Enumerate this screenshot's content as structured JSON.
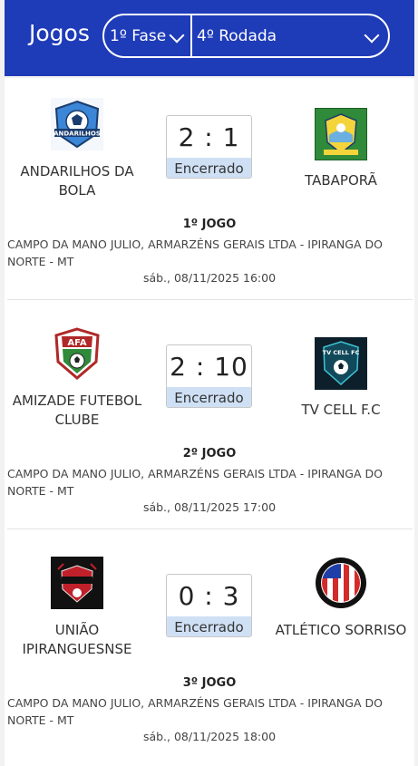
{
  "header": {
    "title": "Jogos",
    "phase": "1º Fase",
    "round": "4º Rodada"
  },
  "matches": [
    {
      "home": "ANDARILHOS DA BOLA",
      "away": "TABAPORÃ",
      "score": "2 : 1",
      "status": "Encerrado",
      "game": "1º JOGO",
      "venue": "CAMPO DA MANO JULIO, ARMARZÉNS GERAIS LTDA - IPIRANGA DO NORTE - MT",
      "date": "sáb., 08/11/2025 16:00",
      "home_logo_text": "ANDARILHOS"
    },
    {
      "home": "AMIZADE FUTEBOL CLUBE",
      "away": "TV CELL F.C",
      "score": "2 : 10",
      "status": "Encerrado",
      "game": "2º JOGO",
      "venue": "CAMPO DA MANO JULIO, ARMARZÉNS GERAIS LTDA - IPIRANGA DO NORTE - MT",
      "date": "sáb., 08/11/2025 17:00",
      "home_logo_text": "AFA",
      "away_logo_text": "TV CELL FC"
    },
    {
      "home": "UNIÃO IPIRANGUESNSE",
      "away": "ATLÉTICO SORRISO",
      "score": "0 : 3",
      "status": "Encerrado",
      "game": "3º JOGO",
      "venue": "CAMPO DA MANO JULIO, ARMARZÉNS GERAIS LTDA - IPIRANGA DO NORTE - MT",
      "date": "sáb., 08/11/2025 18:00"
    }
  ],
  "colors": {
    "header_bg": "#1e3bb8",
    "status_bg": "#cfe0f5"
  }
}
